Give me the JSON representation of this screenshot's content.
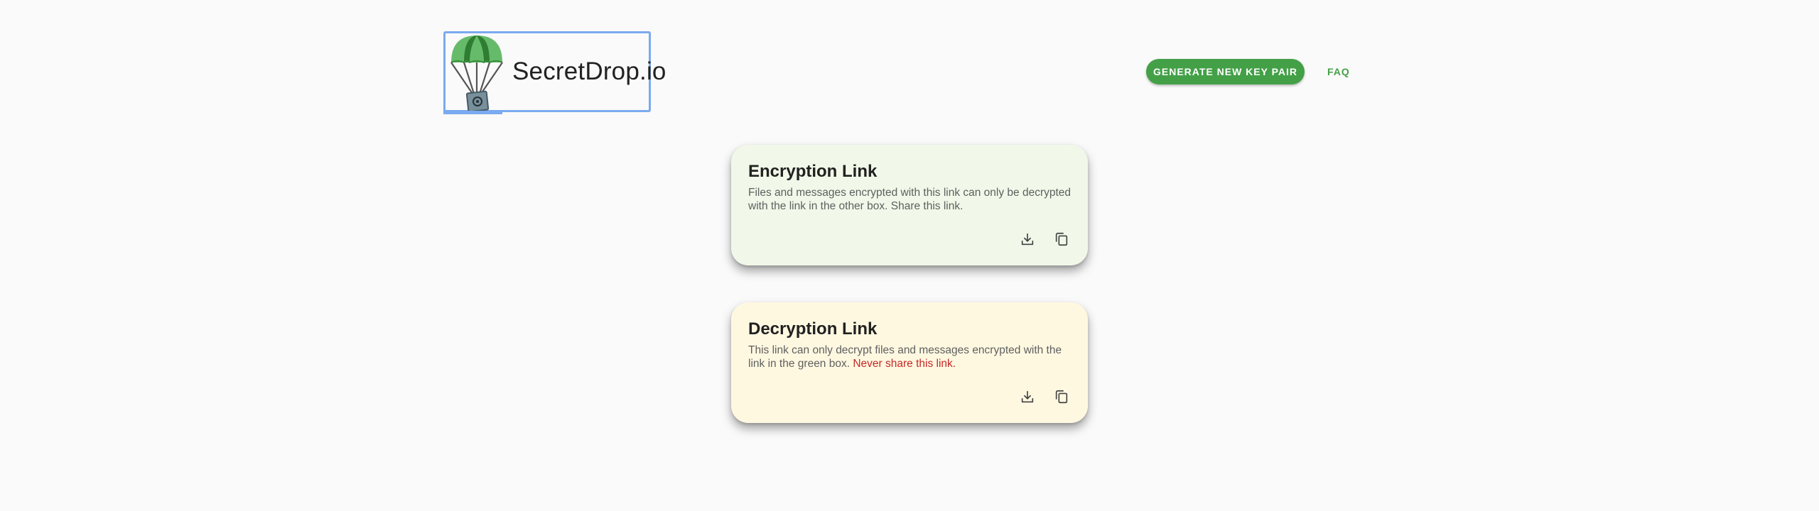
{
  "header": {
    "logo_text": "SecretDrop.io",
    "generate_button_label": "GENERATE NEW KEY PAIR",
    "faq_label": "FAQ"
  },
  "cards": {
    "encryption": {
      "title": "Encryption Link",
      "description": "Files and messages encrypted with this link can only be decrypted with the link in the other box. Share this link.",
      "icons": [
        "download-icon",
        "copy-icon"
      ]
    },
    "decryption": {
      "title": "Decryption Link",
      "description": "This link can only decrypt files and messages encrypted with the link in the green box.",
      "warning": "Never share this link.",
      "icons": [
        "download-icon",
        "copy-icon"
      ]
    }
  },
  "colors": {
    "brand_green": "#43a047",
    "encryption_card_bg": "#f1f8e9",
    "decryption_card_bg": "#fff8e1",
    "warning_red": "#c62828",
    "focus_outline": "#7aaaf0"
  }
}
